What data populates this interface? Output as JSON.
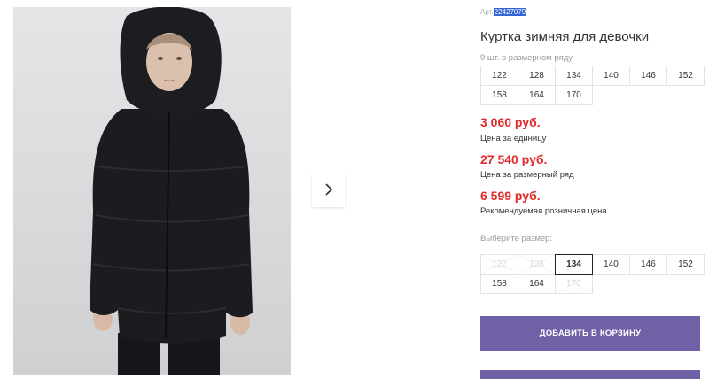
{
  "product": {
    "article_prefix": "Арт.",
    "article_code": "22427079",
    "title": "Куртка зимняя для девочки",
    "pack_info": "9 шт. в размерном ряду"
  },
  "size_range": [
    "122",
    "128",
    "134",
    "140",
    "146",
    "152",
    "158",
    "164",
    "170"
  ],
  "prices": [
    {
      "value": "3 060 руб.",
      "label": "Цена за единицу"
    },
    {
      "value": "27 540 руб.",
      "label": "Цена за размерный ряд"
    },
    {
      "value": "6 599 руб.",
      "label": "Рекомендуемая розничная цена"
    }
  ],
  "size_select": {
    "label": "Выберите размер:",
    "options": [
      {
        "size": "122",
        "available": false,
        "selected": false
      },
      {
        "size": "128",
        "available": false,
        "selected": false
      },
      {
        "size": "134",
        "available": true,
        "selected": true
      },
      {
        "size": "140",
        "available": true,
        "selected": false
      },
      {
        "size": "146",
        "available": true,
        "selected": false
      },
      {
        "size": "152",
        "available": true,
        "selected": false
      },
      {
        "size": "158",
        "available": true,
        "selected": false
      },
      {
        "size": "164",
        "available": true,
        "selected": false
      },
      {
        "size": "170",
        "available": false,
        "selected": false
      }
    ]
  },
  "cart_button_label": "ДОБАВИТЬ В КОРЗИНУ",
  "colors": {
    "accent": "#7060a6",
    "price": "#e22a2a"
  },
  "icons": {
    "gallery_next": "chevron-right-icon"
  }
}
